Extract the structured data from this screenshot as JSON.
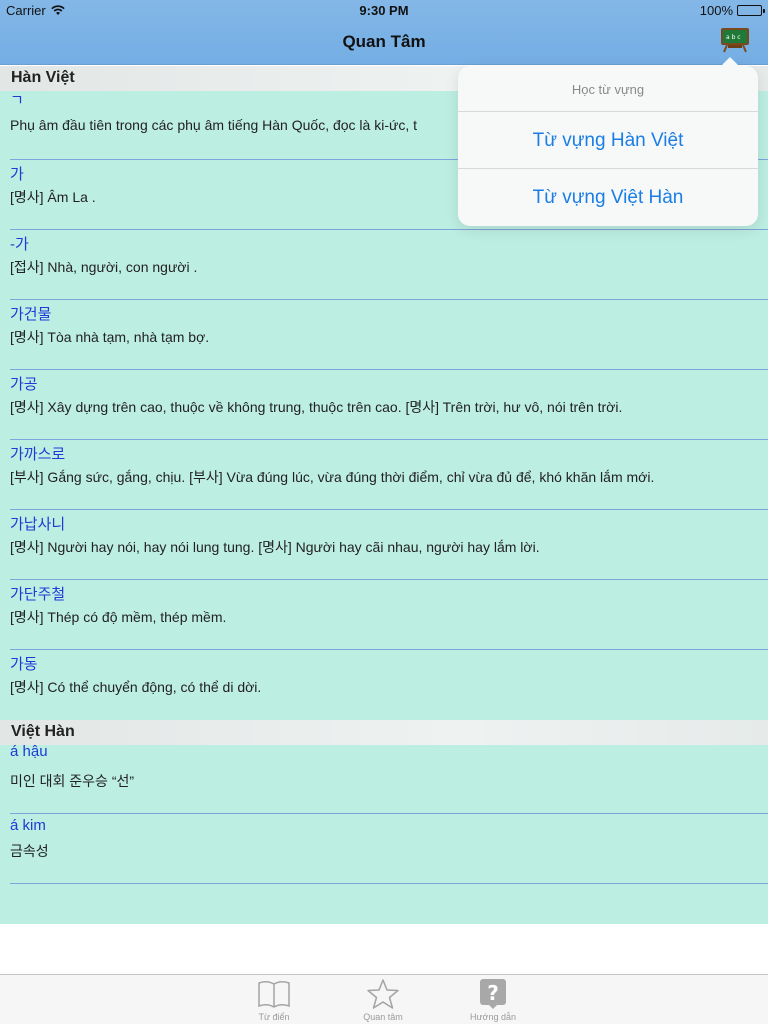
{
  "status": {
    "carrier": "Carrier",
    "time": "9:30 PM",
    "battery": "100%"
  },
  "nav": {
    "title": "Quan Tâm",
    "menu_icon": "blackboard-abc-icon"
  },
  "sections": {
    "han_viet": {
      "header": "Hàn Việt",
      "entries": [
        {
          "word": "ㄱ",
          "meaning": "Phụ âm đầu tiên trong các phụ âm tiếng Hàn Quốc, đọc là ki-ức, t"
        },
        {
          "word": "가",
          "meaning": "[명사] Âm La ."
        },
        {
          "word": "-가",
          "meaning": "[접사] Nhà, người, con người ."
        },
        {
          "word": "가건물",
          "meaning": "[명사] Tòa nhà tạm, nhà tạm bợ."
        },
        {
          "word": "가공",
          "meaning": "[명사] Xây dựng trên cao, thuộc về không trung, thuộc trên cao. [명사] Trên trời, hư vô, nói trên trời."
        },
        {
          "word": "가까스로",
          "meaning": "[부사] Gắng sức, gắng, chịu. [부사] Vừa đúng lúc, vừa đúng thời điểm, chỉ vừa đủ để, khó khăn lắm mới."
        },
        {
          "word": "가납사니",
          "meaning": "[명사] Người hay nói, hay nói lung tung. [명사] Người hay cãi nhau, người hay lắm lời."
        },
        {
          "word": "가단주철",
          "meaning": "[명사] Thép có độ mềm, thép mềm."
        },
        {
          "word": "가동",
          "meaning": "[명사] Có thể chuyển động, có thể di dời."
        }
      ]
    },
    "viet_han": {
      "header": "Việt Hàn",
      "entries": [
        {
          "word": "á hậu",
          "meaning": "미인 대회 준우승 “선”"
        },
        {
          "word": "á kim",
          "meaning": "금속성"
        }
      ]
    }
  },
  "popover": {
    "title": "Học từ vựng",
    "items": [
      "Từ vựng Hàn Việt",
      "Từ vựng Việt Hàn"
    ]
  },
  "tabbar": {
    "tabs": [
      {
        "label": "Từ điển",
        "icon": "open-book-icon"
      },
      {
        "label": "Quan tâm",
        "icon": "star-icon"
      },
      {
        "label": "Hướng dẫn",
        "icon": "question-mark-icon"
      }
    ]
  },
  "colors": {
    "navbar": "#7ab2e6",
    "content_bg": "#bdeee2",
    "word": "#1d3bd6",
    "popover_link": "#1a7ee6"
  }
}
